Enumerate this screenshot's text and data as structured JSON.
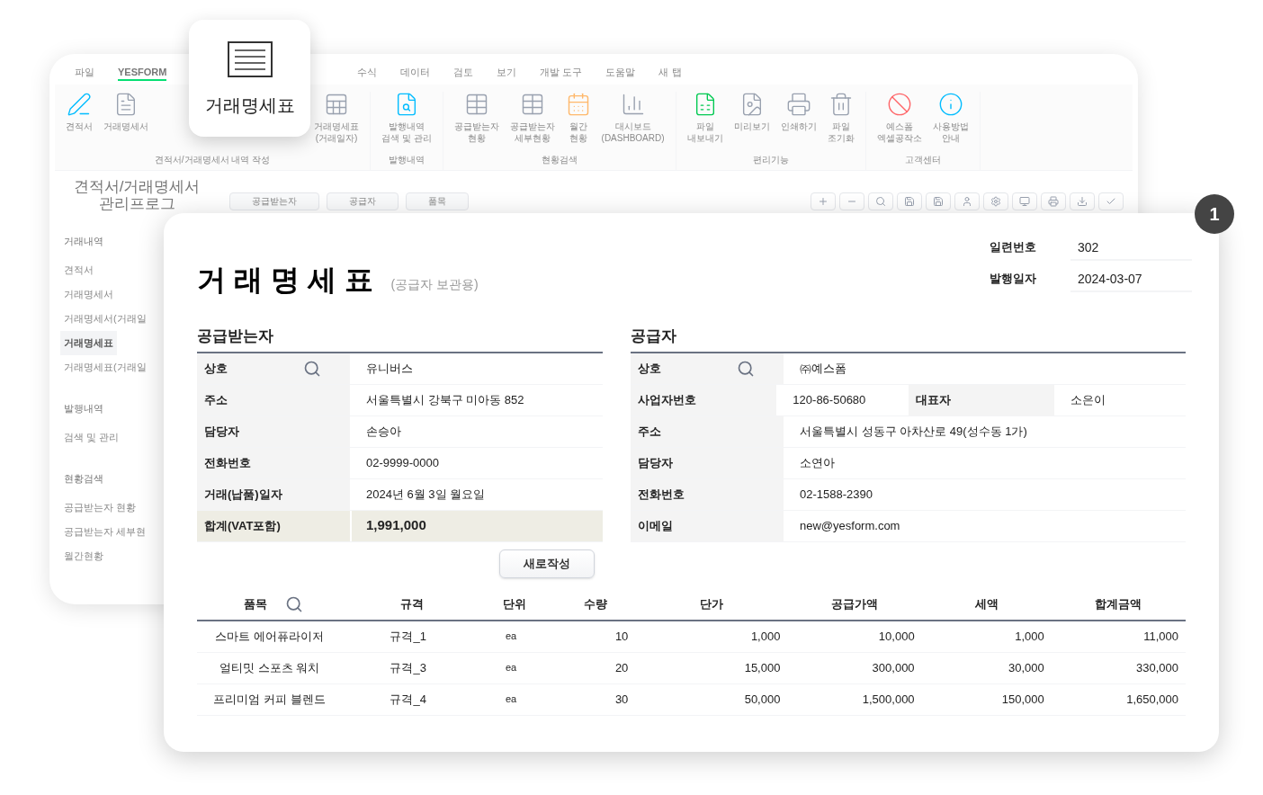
{
  "back_window": {
    "tabs": [
      {
        "label": "파일",
        "selected": false
      },
      {
        "label": "YESFORM",
        "selected": true
      },
      {
        "label": "수식",
        "selected": false
      },
      {
        "label": "데이터",
        "selected": false
      },
      {
        "label": "검토",
        "selected": false
      },
      {
        "label": "보기",
        "selected": false
      },
      {
        "label": "개발 도구",
        "selected": false
      },
      {
        "label": "도움말",
        "selected": false
      },
      {
        "label": "새 탭",
        "selected": false
      }
    ],
    "ribbon_groups": [
      {
        "label": "견적서/거래명세서 내역 작성",
        "items": [
          {
            "label": "견적서"
          },
          {
            "label": "거래명세서"
          },
          {
            "label": "거래명세표\n(거래일자)"
          }
        ]
      },
      {
        "label": "발행내역",
        "items": [
          {
            "label": "발행내역\n검색 및 관리"
          }
        ]
      },
      {
        "label": "현황검색",
        "items": [
          {
            "label": "공급받는자\n현황"
          },
          {
            "label": "공급받는자\n세부현황"
          },
          {
            "label": "월간\n현황"
          },
          {
            "label": "대시보드\n(DASHBOARD)"
          }
        ]
      },
      {
        "label": "편리기능",
        "items": [
          {
            "label": "파일\n내보내기"
          },
          {
            "label": "미리보기"
          },
          {
            "label": "인쇄하기"
          },
          {
            "label": "파일\n조기화"
          }
        ]
      },
      {
        "label": "고객센터",
        "items": [
          {
            "label": "예스폼\n엑셀공작소"
          },
          {
            "label": "사용방법\n안내"
          }
        ]
      }
    ],
    "sidebar": {
      "title": "견적서/거래명세서\n관리프로그",
      "groups": [
        {
          "label": "거래내역",
          "items": [
            {
              "label": "견적서",
              "selected": false
            },
            {
              "label": "거래명세서",
              "selected": false
            },
            {
              "label": "거래명세서(거래일",
              "selected": false
            },
            {
              "label": "거래명세표",
              "selected": true
            },
            {
              "label": "거래명세표(거래일",
              "selected": false
            }
          ]
        },
        {
          "label": "발행내역",
          "items": [
            {
              "label": "검색 및 관리",
              "selected": false
            }
          ]
        },
        {
          "label": "현황검색",
          "items": [
            {
              "label": "공급받는자 현황",
              "selected": false
            },
            {
              "label": "공급받는자 세부현",
              "selected": false
            },
            {
              "label": "월간현황",
              "selected": false
            }
          ]
        }
      ]
    },
    "toolbar_tabs": [
      "공급받는자",
      "공급자",
      "품목"
    ]
  },
  "popup": {
    "label": "거래명세표"
  },
  "callout": "1",
  "document": {
    "title": "거 래 명 세 표",
    "subtitle": "(공급자 보관용)",
    "meta": [
      {
        "label": "일련번호",
        "value": "302"
      },
      {
        "label": "발행일자",
        "value": "2024-03-07"
      }
    ],
    "sections": [
      {
        "title": "공급받는자",
        "rows": [
          {
            "cells": [
              {
                "label": "상호",
                "search": true
              },
              {
                "value": "유니버스"
              }
            ],
            "highlight": false
          },
          {
            "cells": [
              {
                "label": "주소",
                "search": false
              },
              {
                "value": "서울특별시 강북구 미아동 852"
              }
            ],
            "highlight": false
          },
          {
            "cells": [
              {
                "label": "담당자",
                "search": false
              },
              {
                "value": "손승아"
              }
            ],
            "highlight": false
          },
          {
            "cells": [
              {
                "label": "전화번호",
                "search": false
              },
              {
                "value": "02-9999-0000"
              }
            ],
            "highlight": false
          },
          {
            "cells": [
              {
                "label": "거래(납품)일자",
                "search": false
              },
              {
                "value": "2024년 6월 3일 월요일"
              }
            ],
            "highlight": false
          },
          {
            "cells": [
              {
                "label": "합계(VAT포함)",
                "search": false
              },
              {
                "value": "1,991,000"
              }
            ],
            "highlight": true
          }
        ]
      },
      {
        "title": "공급자",
        "rows": [
          {
            "cells": [
              {
                "label": "상호",
                "search": true
              },
              {
                "value": "㈜예스폼"
              }
            ],
            "highlight": false
          },
          {
            "cells": [
              {
                "label": "사업자번호",
                "search": false
              },
              {
                "value": "120-86-50680"
              },
              {
                "label": "대표자",
                "search": false
              },
              {
                "value": "소은이"
              }
            ],
            "highlight": false
          },
          {
            "cells": [
              {
                "label": "주소",
                "search": false
              },
              {
                "value": "서울특별시 성동구 아차산로 49(성수동 1가)"
              }
            ],
            "highlight": false
          },
          {
            "cells": [
              {
                "label": "담당자",
                "search": false
              },
              {
                "value": "소연아"
              }
            ],
            "highlight": false
          },
          {
            "cells": [
              {
                "label": "전화번호",
                "search": false
              },
              {
                "value": "02-1588-2390"
              }
            ],
            "highlight": false
          },
          {
            "cells": [
              {
                "label": "이메일",
                "search": false
              },
              {
                "value": "new@yesform.com"
              }
            ],
            "highlight": false
          }
        ]
      }
    ],
    "new_button": "새로작성",
    "items": {
      "columns": [
        {
          "label": "품목",
          "search": true
        },
        {
          "label": "규격",
          "search": false
        },
        {
          "label": "단위",
          "search": false
        },
        {
          "label": "수량",
          "search": false
        },
        {
          "label": "단가",
          "search": false
        },
        {
          "label": "공급가액",
          "search": false
        },
        {
          "label": "세액",
          "search": false
        },
        {
          "label": "합계금액",
          "search": false
        }
      ],
      "rows": [
        [
          "스마트 에어퓨라이저",
          "규격_1",
          "ea",
          "10",
          "1,000",
          "10,000",
          "1,000",
          "11,000"
        ],
        [
          "얼티밋 스포츠 워치",
          "규격_3",
          "ea",
          "20",
          "15,000",
          "300,000",
          "30,000",
          "330,000"
        ],
        [
          "프리미엄 커피 블렌드",
          "규격_4",
          "ea",
          "30",
          "50,000",
          "1,500,000",
          "150,000",
          "1,650,000"
        ]
      ]
    }
  }
}
